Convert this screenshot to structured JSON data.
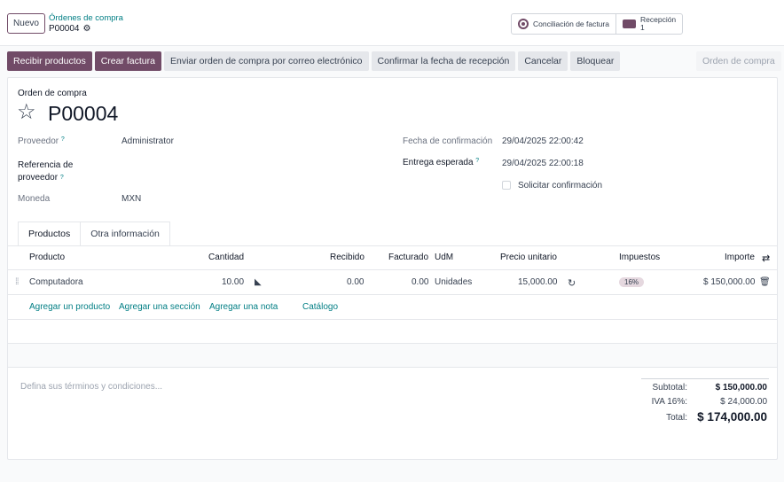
{
  "topbar": {
    "new_button": "Nuevo",
    "breadcrumb_parent": "Órdenes de compra",
    "breadcrumb_current": "P00004",
    "smart_buttons": [
      {
        "label": "Conciliación de factura",
        "icon": "reconcile-icon"
      },
      {
        "label": "Recepción",
        "count": "1",
        "icon": "truck-icon"
      }
    ]
  },
  "actions": {
    "receive": "Recibir productos",
    "invoice": "Crear factura",
    "email": "Enviar orden de compra por correo electrónico",
    "confirm_date": "Confirmar la fecha de recepción",
    "cancel": "Cancelar",
    "lock": "Bloquear",
    "status": "Orden de compra"
  },
  "form": {
    "doc_type": "Orden de compra",
    "name": "P00004",
    "vendor_label": "Proveedor",
    "vendor_value": "Administrator",
    "vendor_ref_label_1": "Referencia de",
    "vendor_ref_label_2": "proveedor",
    "currency_label": "Moneda",
    "currency_value": "MXN",
    "confirm_date_label": "Fecha de confirmación",
    "confirm_date_value": "29/04/2025 22:00:42",
    "expected_label": "Entrega esperada",
    "expected_value": "29/04/2025 22:00:18",
    "ask_confirm_label": "Solicitar confirmación",
    "help_mark": "?"
  },
  "tabs": [
    "Productos",
    "Otra información"
  ],
  "table": {
    "headers": [
      "Producto",
      "Cantidad",
      "Recibido",
      "Facturado",
      "UdM",
      "Precio unitario",
      "Impuestos",
      "Importe"
    ],
    "rows": [
      {
        "product": "Computadora",
        "qty": "10.00",
        "received": "0.00",
        "invoiced": "0.00",
        "uom": "Unidades",
        "price": "15,000.00",
        "tax": "16%",
        "amount": "$ 150,000.00"
      }
    ],
    "add_links": [
      "Agregar un producto",
      "Agregar una sección",
      "Agregar una nota",
      "Catálogo"
    ]
  },
  "terms_placeholder": "Defina sus términos y condiciones...",
  "totals": {
    "subtotal_label": "Subtotal:",
    "subtotal_value": "$ 150,000.00",
    "tax_label": "IVA 16%:",
    "tax_value": "$ 24,000.00",
    "total_label": "Total:",
    "total_value": "$ 174,000.00"
  },
  "colors": {
    "primary": "#714b67",
    "link": "#017e84"
  }
}
